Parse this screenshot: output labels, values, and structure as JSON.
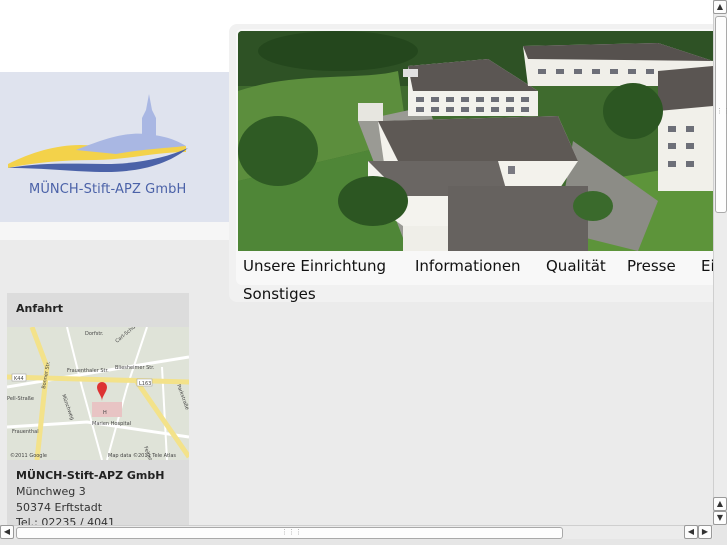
{
  "brand": {
    "name": "MÜNCH-Stift-APZ GmbH"
  },
  "nav": {
    "items": [
      "Unsere Einrichtung",
      "Informationen",
      "Qualität",
      "Presse",
      "Ei",
      "Sonstiges"
    ]
  },
  "sidebar": {
    "title": "Anfahrt",
    "map": {
      "labels": [
        "Dorfstr.",
        "Carl-Schurz-Str.",
        "Frauenthaler Str.",
        "Bliesheimer Str.",
        "K44",
        "L163",
        "Pell-Straße",
        "Münchweg",
        "Bonner Str.",
        "Frauenthal",
        "Marien Hospital",
        "Parkstraße",
        "Feldstraße",
        "H"
      ],
      "copyright_left": "©2011 Google",
      "copyright_right": "Map data ©2011 Tele Atlas"
    },
    "address": {
      "name": "MÜNCH-Stift-APZ GmbH",
      "street": "Münchweg 3",
      "city": "50374 Erftstadt",
      "phone": "Tel.: 02235 / 4041"
    }
  },
  "colors": {
    "accent_blue": "#4b62a8",
    "logo_yellow": "#f3d24a",
    "logo_lightblue": "#a9b7e3"
  }
}
